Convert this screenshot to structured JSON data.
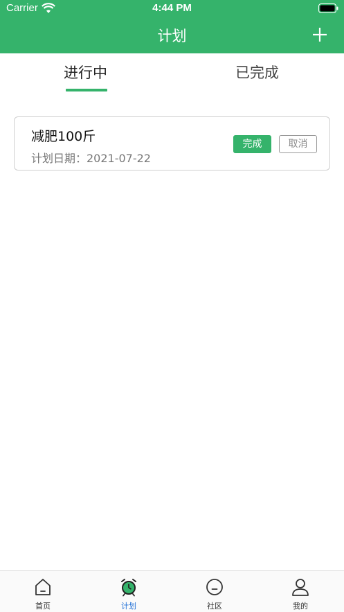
{
  "status": {
    "carrier": "Carrier",
    "time": "4:44 PM"
  },
  "nav": {
    "title": "计划",
    "add_icon": "plus-icon"
  },
  "tabs": [
    {
      "label": "进行中",
      "active": true
    },
    {
      "label": "已完成",
      "active": false
    }
  ],
  "plans": [
    {
      "title": "减肥100斤",
      "date": "计划日期：2021-07-22",
      "done_label": "完成",
      "cancel_label": "取消"
    }
  ],
  "tabbar": {
    "items": [
      {
        "label": "首页",
        "icon": "home-icon",
        "active": false
      },
      {
        "label": "计划",
        "icon": "alarm-clock-icon",
        "active": true
      },
      {
        "label": "社区",
        "icon": "community-icon",
        "active": false
      },
      {
        "label": "我的",
        "icon": "profile-icon",
        "active": false
      }
    ]
  },
  "colors": {
    "accent": "#35b36b",
    "active_tab_label": "#1f6fd6"
  }
}
